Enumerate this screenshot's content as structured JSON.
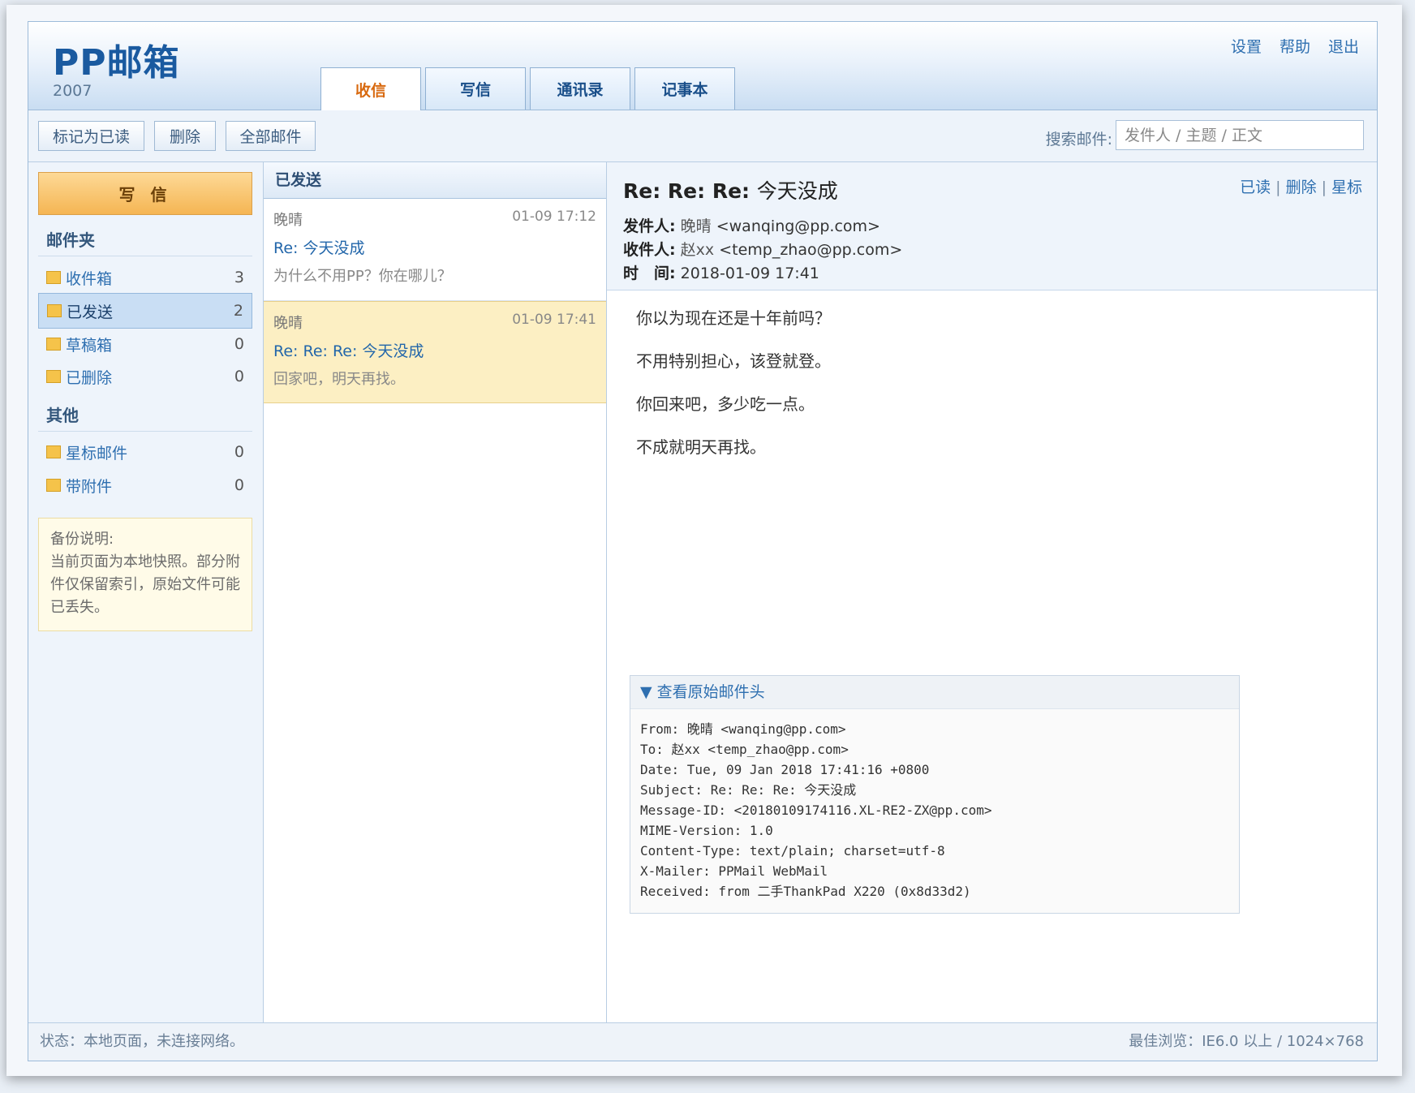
{
  "app": {
    "logo": "PP邮箱",
    "year": "2007"
  },
  "top_links": [
    "设置",
    "帮助",
    "退出"
  ],
  "tabs": [
    {
      "label": "收信",
      "active": true
    },
    {
      "label": "写信",
      "active": false
    },
    {
      "label": "通讯录",
      "active": false
    },
    {
      "label": "记事本",
      "active": false
    }
  ],
  "toolbar": {
    "mark_read": "标记为已读",
    "delete": "删除",
    "all_mail": "全部邮件",
    "search_label": "搜索邮件:",
    "search_placeholder": "发件人 / 主题 / 正文"
  },
  "sidebar": {
    "compose": "写 信",
    "folders_title": "邮件夹",
    "folders": [
      {
        "label": "收件箱",
        "count": "3"
      },
      {
        "label": "已发送",
        "count": "2",
        "active": true
      },
      {
        "label": "草稿箱",
        "count": "0"
      },
      {
        "label": "已删除",
        "count": "0"
      }
    ],
    "other_title": "其他",
    "other": [
      {
        "label": "星标邮件",
        "count": "0"
      },
      {
        "label": "带附件",
        "count": "0"
      }
    ],
    "note": "备份说明:\n当前页面为本地快照。部分附件仅保留索引，原始文件可能已丢失。"
  },
  "list": {
    "title": "已发送",
    "messages": [
      {
        "from": "晚晴",
        "date": "01-09 17:12",
        "subject": "Re: 今天没成",
        "snippet": "为什么不用PP？你在哪儿？"
      },
      {
        "from": "晚晴",
        "date": "01-09 17:41",
        "subject": "Re: Re: Re: 今天没成",
        "snippet": "回家吧，明天再找。",
        "active": true
      }
    ]
  },
  "reader": {
    "subject_prefix": "Re: Re: Re:",
    "subject_main": "今天没成",
    "actions": [
      "已读",
      "删除",
      "星标"
    ],
    "from_label": "发件人:",
    "from_name": "晚晴",
    "from_addr": "<wanqing@pp.com>",
    "to_label": "收件人:",
    "to_name": "赵xx",
    "to_addr": "<temp_zhao@pp.com>",
    "time_label": "时　间:",
    "time_value": "2018-01-09 17:41",
    "body": [
      "你以为现在还是十年前吗？",
      "不用特别担心，该登就登。",
      "你回来吧，多少吃一点。",
      "不成就明天再找。"
    ],
    "raw_toggle": "▼ 查看原始邮件头",
    "raw_headers": [
      "From: 晚晴 <wanqing@pp.com>",
      "To: 赵xx <temp_zhao@pp.com>",
      "Date: Tue, 09 Jan 2018 17:41:16 +0800",
      "Subject: Re: Re: Re: 今天没成",
      "Message-ID: <20180109174116.XL-RE2-ZX@pp.com>",
      "MIME-Version: 1.0",
      "Content-Type: text/plain; charset=utf-8",
      "X-Mailer: PPMail WebMail",
      "Received: from 二手ThankPad X220 (0x8d33d2)"
    ]
  },
  "status": {
    "left": "状态：本地页面，未连接网络。",
    "right": "最佳浏览：IE6.0 以上 / 1024×768"
  }
}
